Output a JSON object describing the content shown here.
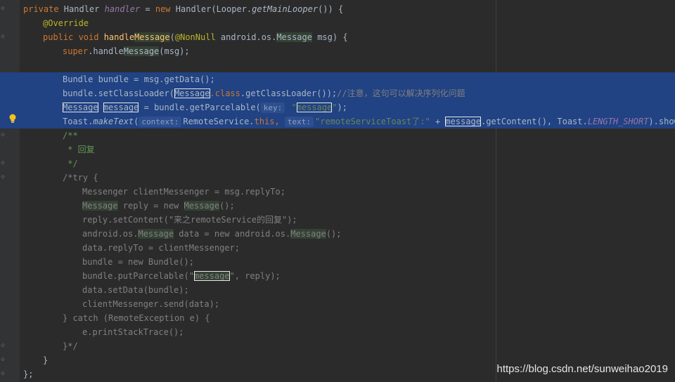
{
  "editor": {
    "lines": [
      {
        "segs": [
          [
            "kw",
            "private "
          ],
          [
            "",
            "Handler "
          ],
          [
            "stat",
            "handler"
          ],
          [
            "",
            " = "
          ],
          [
            "kw",
            "new "
          ],
          [
            "",
            "Handler(Looper."
          ],
          [
            "ital",
            "getMainLooper"
          ],
          [
            "",
            "()) {"
          ]
        ]
      },
      {
        "segs": [
          [
            "ann",
            "@Override"
          ]
        ]
      },
      {
        "segs": [
          [
            "kw",
            "public void "
          ],
          [
            "fn",
            "handle"
          ],
          [
            "fn hl-green",
            "Message"
          ],
          [
            "",
            "("
          ],
          [
            "ann",
            "@NonNull "
          ],
          [
            "",
            "android.os."
          ],
          [
            "hl-green",
            "Message"
          ],
          [
            "",
            " msg) {"
          ]
        ]
      },
      {
        "segs": [
          [
            "kw",
            "super"
          ],
          [
            "",
            ".handle"
          ],
          [
            "hl-green",
            "Message"
          ],
          [
            "",
            "(msg);"
          ]
        ]
      },
      {
        "segs": []
      },
      {
        "segs": [
          [
            "",
            "Bundle bundle = msg.getData();"
          ]
        ]
      },
      {
        "segs": [
          [
            "",
            "bundle.setClassLoader("
          ],
          [
            "boxed",
            "Message"
          ],
          [
            "kw",
            ".class"
          ],
          [
            "",
            ".getClassLoader());"
          ],
          [
            "cmt",
            "//注意，这句可以解决序列化问题"
          ]
        ]
      },
      {
        "segs": [
          [
            "boxed",
            "Message"
          ],
          [
            "",
            " "
          ],
          [
            "boxed",
            "message"
          ],
          [
            "",
            " = bundle.getParcelable("
          ],
          [
            "hint",
            "key:"
          ],
          [
            "str",
            " \""
          ],
          [
            "str boxed",
            "message"
          ],
          [
            "str",
            "\""
          ],
          [
            "",
            ");"
          ]
        ]
      },
      {
        "segs": [
          [
            "",
            "Toast."
          ],
          [
            "ital",
            "makeText"
          ],
          [
            "",
            "("
          ],
          [
            "hint",
            "context:"
          ],
          [
            "",
            "RemoteService."
          ],
          [
            "kw",
            "this"
          ],
          [
            "kw",
            ", "
          ],
          [
            "hint",
            "text:"
          ],
          [
            "str",
            "\"remoteServiceToast了:\""
          ],
          [
            "",
            " + "
          ],
          [
            "boxed",
            "message"
          ],
          [
            "",
            ".getContent(), Toast."
          ],
          [
            "stat",
            "LENGTH_SHORT"
          ],
          [
            "",
            ").show();"
          ]
        ]
      },
      {
        "segs": [
          [
            "doc",
            "/**"
          ]
        ]
      },
      {
        "segs": [
          [
            "doc",
            " * 回复"
          ]
        ]
      },
      {
        "segs": [
          [
            "doc",
            " */"
          ]
        ]
      },
      {
        "segs": [
          [
            "cmt",
            "/*try {"
          ]
        ]
      },
      {
        "segs": [
          [
            "cmt",
            "Messenger clientMessenger = msg.replyTo;"
          ]
        ]
      },
      {
        "segs": [
          [
            "cmt hl-green",
            "Message"
          ],
          [
            "cmt",
            " reply = new "
          ],
          [
            "cmt hl-green",
            "Message"
          ],
          [
            "cmt",
            "();"
          ]
        ]
      },
      {
        "segs": [
          [
            "cmt",
            "reply.setContent(\"来之remoteService的回复\");"
          ]
        ]
      },
      {
        "segs": [
          [
            "cmt",
            "android.os."
          ],
          [
            "cmt hl-green",
            "Message"
          ],
          [
            "cmt",
            " data = new android.os."
          ],
          [
            "cmt hl-green",
            "Message"
          ],
          [
            "cmt",
            "();"
          ]
        ]
      },
      {
        "segs": [
          [
            "cmt",
            "data.replyTo = clientMessenger;"
          ]
        ]
      },
      {
        "segs": [
          [
            "cmt",
            "bundle = new Bundle();"
          ]
        ]
      },
      {
        "segs": [
          [
            "cmt",
            "bundle.putParcelable(\""
          ],
          [
            "cmt hl-green boxed",
            "message"
          ],
          [
            "cmt",
            "\", reply);"
          ]
        ]
      },
      {
        "segs": [
          [
            "cmt",
            "data.setData(bundle);"
          ]
        ]
      },
      {
        "segs": [
          [
            "cmt",
            "clientMessenger.send(data);"
          ]
        ]
      },
      {
        "segs": [
          [
            "cmt",
            "} catch (RemoteException e) {"
          ]
        ]
      },
      {
        "segs": [
          [
            "cmt",
            "e.printStackTrace();"
          ]
        ]
      },
      {
        "segs": [
          [
            "cmt",
            "}*/"
          ]
        ]
      },
      {
        "segs": [
          [
            "",
            "}"
          ]
        ]
      },
      {
        "segs": [
          [
            "",
            "};"
          ]
        ]
      }
    ]
  },
  "watermark": "https://blog.csdn.net/sunweihao2019",
  "icons": {
    "bulb": "lightbulb-icon",
    "fold": "fold-marker-icon"
  },
  "colors": {
    "background": "#2b2b2b",
    "selection": "#214283",
    "keyword": "#cc7832",
    "string": "#6a8759",
    "comment": "#808080"
  }
}
